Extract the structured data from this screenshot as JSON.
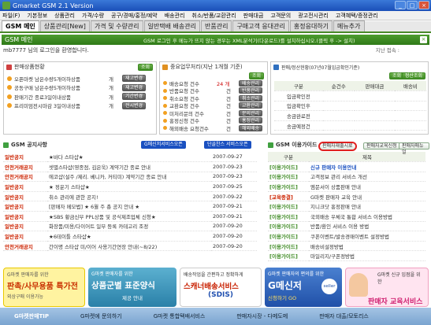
{
  "window": {
    "title": "Gmarket GSM 2.1 Version"
  },
  "menu": [
    "파일(F)",
    "기본정보",
    "상품관리",
    "가격/수량",
    "공구/경매/홍정/예약",
    "배송관리",
    "취소/반품/교환관리",
    "판매대금",
    "고객문의",
    "광고전시관리",
    "고객혜택/증정관리"
  ],
  "tabs": [
    "GSM 메인",
    "상품관리[New]",
    "가격 및 수량관리",
    "일반택배 배송관리",
    "반품관리",
    "구매고객 응대관리",
    "홍정응대하기",
    "메뉴추가"
  ],
  "gsm_bar": {
    "title": "GSM 메인",
    "notice": "GSM 로그인 후 메뉴가 뜨지 않는 경우는 XML분석기(다운로드)를 설치하십시오.(클릭 후 -> 설치)",
    "close": "×"
  },
  "welcome": "mb7777 님의 로그인을 환영합니다.",
  "last_login": "지난 접속 :",
  "sales_panel": {
    "title": "판매상품현황",
    "btn": "조회",
    "rows": [
      {
        "label": "오픈마켓 남은수량5개이하상품",
        "unit": "개",
        "btn": "재고변경"
      },
      {
        "label": "공동구매 남은수량5개이하상품",
        "unit": "개",
        "btn": "재고변경"
      },
      {
        "label": "판매기간 종료3일이내상품",
        "unit": "개",
        "btn": "기간변경"
      },
      {
        "label": "프리미엄전시마감 3일이내상품",
        "unit": "개",
        "btn": "전시변경"
      }
    ]
  },
  "todo_panel": {
    "title": "중요업무처리(지난 1개월 기준)",
    "btn": "조회",
    "rows": [
      {
        "label": "배송요청 건수",
        "count": "24 개",
        "btn": "배송관리"
      },
      {
        "label": "반품요청 건수",
        "count": "건",
        "btn": "반품관리"
      },
      {
        "label": "취소요청 건수",
        "count": "건",
        "btn": "취소관리"
      },
      {
        "label": "교환요청 건수",
        "count": "건",
        "btn": "교환관리"
      },
      {
        "label": "미처리문의 건수",
        "count": "건",
        "btn": "문의관리"
      },
      {
        "label": "홍정신청 건수",
        "count": "건",
        "btn": "홍정관리"
      },
      {
        "label": "해외배송 요청건수",
        "count": "건",
        "btn": "해외배송"
      }
    ]
  },
  "settle_panel": {
    "title": "판매/정산현황(07년07월입금확인기준)",
    "btn": "조회",
    "btn2": "정산조회",
    "headers": [
      "구분",
      "순건수",
      "판매대금",
      "배송비"
    ],
    "rows": [
      "입금확인전",
      "입금확인후",
      "송금완료전",
      "송금예정건"
    ]
  },
  "notice_panel": {
    "title": "GSM 공지사항",
    "btn1": "G메신저서비스오픈",
    "btn2": "단골찬스 서비스오픈",
    "items": [
      {
        "tag": "일반공지",
        "title": "★바다 스타샵★",
        "date": "2007-09-27"
      },
      {
        "tag": "안전거래공지",
        "title": "셋별스타샵(영종점, 김은욱) 계약기간 종료 안내",
        "date": "2007-09-23"
      },
      {
        "tag": "안전거래공지",
        "title": "에코샵(설주 /제리. 베니카, 커티미) 계약기간 종료 안내",
        "date": "2007-09-23"
      },
      {
        "tag": "일반공지",
        "title": "★ 정운기 스타샵★",
        "date": "2007-09-25"
      },
      {
        "tag": "일반공지",
        "title": "취소 관리에 관한 공지!",
        "date": "2007-09-22"
      },
      {
        "tag": "일반공지",
        "title": "[판매자 메모법] ★ 6월 주 총 공지 안내 ★",
        "date": "2007-09-21"
      },
      {
        "tag": "일반공지",
        "title": "★SBS 황금신부 PPL상품 및 공식제조업체 신청★",
        "date": "2007-09-21"
      },
      {
        "tag": "일반공지",
        "title": "화장품/미용/다이어트 일부 등록 카테고리 조정",
        "date": "2007-09-20"
      },
      {
        "tag": "일반공지",
        "title": "★6테이틀 스타샵★",
        "date": "2007-09-20"
      },
      {
        "tag": "안전거래공지",
        "title": "간이명 스타샵 미/이어 사용기간연장 안내(~8/22)",
        "date": "2007-09-20"
      }
    ]
  },
  "guide_panel": {
    "title": "GSM 이용가이드",
    "tabs": [
      "판매자재출시료",
      "판매자교육신청",
      "판매자매뉴얼"
    ],
    "headers": [
      "구분",
      "제목"
    ],
    "items": [
      {
        "tag": "[이용가이드]",
        "title": "신규 판매자 이용안내"
      },
      {
        "tag": "[이용가이드]",
        "title": "고객정보 관리 서비스 개선"
      },
      {
        "tag": "[이용가이드]",
        "title": "엠문서이 상품판매 안내"
      },
      {
        "tag": "[교육종결]",
        "title": "G마켓 판매자 교육 안내"
      },
      {
        "tag": "[이용가이드]",
        "title": "지니크닷 홍정판매 안내"
      },
      {
        "tag": "[이용가이드]",
        "title": "국외배송 우체국 통합 서비스 이용방법"
      },
      {
        "tag": "[이용가이드]",
        "title": "반품/환인 서비스 이용 방법"
      },
      {
        "tag": "[이용가이드]",
        "title": "쿠폰이벤트/발송경매이벤트 설정방법"
      },
      {
        "tag": "[이용가이드]",
        "title": "배송비설정방법"
      },
      {
        "tag": "[이용가이드]",
        "title": "마일리지/구폰정방법"
      }
    ]
  },
  "banners": [
    {
      "small": "G마켓 판매자를 위한",
      "big": "판촉/사무용품 특가전",
      "sub": "외상구매 이용가능"
    },
    {
      "small": "G마켓 판매자를 위한",
      "big": "상품군별 표준양식",
      "sub": "제공 안내"
    },
    {
      "small": "배송작업을 간편하고 정확하게",
      "big": "스캐너배송서비스",
      "sub": "(SDIS)"
    },
    {
      "small": "G마켓 판매자의 편의를 위한",
      "big": "G메신저",
      "sub": "신청하기 GO"
    },
    {
      "small": "G마켓 신규 입점을 위한",
      "big": "판매자 교육서비스",
      "sub": ""
    }
  ],
  "bottom": {
    "label": "G마켓판매TIP",
    "items": [
      "G마켓에 문의하기",
      "G마켓 통합택배서비스",
      "판매자시장 - 다메도메",
      "판매자 대출/모토리스"
    ]
  },
  "colors": {
    "green": "#3d8a22",
    "red_tag": "#cc2200",
    "blue_title": "#1a50c0",
    "highlight": "#e02020"
  }
}
